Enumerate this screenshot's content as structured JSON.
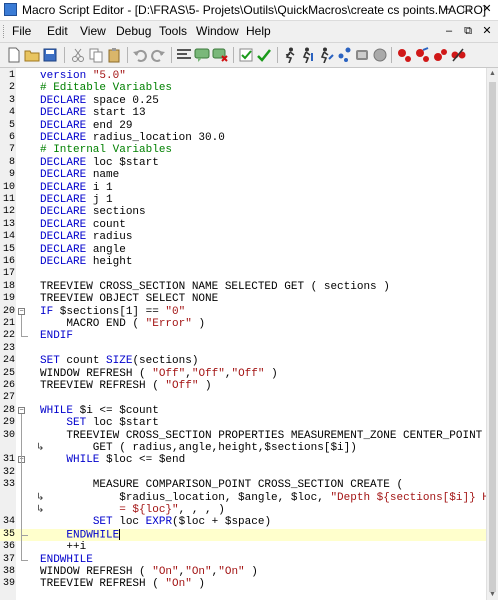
{
  "window": {
    "title": "Macro Script Editor - [D:\\FRAS\\5- Projets\\Outils\\QuickMacros\\create cs points.MACRO]",
    "buttons": {
      "minimize": "–",
      "maximize": "□",
      "close": "✕"
    }
  },
  "menu": {
    "items": [
      "File",
      "Edit",
      "View",
      "Debug",
      "Tools",
      "Window",
      "Help"
    ],
    "controls": {
      "minimize": "–",
      "restore": "⧉",
      "close": "✕"
    }
  },
  "toolbar": {
    "icons": [
      "new-file-icon",
      "open-folder-icon",
      "save-icon",
      "cut-icon",
      "copy-icon",
      "paste-icon",
      "undo-icon",
      "redo-icon",
      "insert-command-icon",
      "insert-comment-icon",
      "delete-comment-icon",
      "validate-icon",
      "check-syntax-icon",
      "run-icon",
      "step-into-icon",
      "step-over-icon",
      "step-out-icon",
      "run-to-cursor-icon",
      "stop-icon",
      "toggle-breakpoint-icon",
      "clear-breakpoints-icon",
      "breakpoint-next-icon",
      "breakpoint-prev-icon"
    ]
  },
  "editor": {
    "current_line": 35,
    "lines": [
      {
        "n": "1",
        "seg": [
          [
            "kw",
            "version"
          ],
          [
            "",
            ""
          ],
          [
            "str",
            " \"5.0\""
          ]
        ]
      },
      {
        "n": "2",
        "seg": [
          [
            "cm",
            "# Editable Variables"
          ]
        ]
      },
      {
        "n": "3",
        "seg": [
          [
            "kw",
            "DECLARE"
          ],
          [
            "",
            " space 0.25"
          ]
        ]
      },
      {
        "n": "4",
        "seg": [
          [
            "kw",
            "DECLARE"
          ],
          [
            "",
            " start 13"
          ]
        ]
      },
      {
        "n": "5",
        "seg": [
          [
            "kw",
            "DECLARE"
          ],
          [
            "",
            " end 29"
          ]
        ]
      },
      {
        "n": "6",
        "seg": [
          [
            "kw",
            "DECLARE"
          ],
          [
            "",
            " radius_location 30.0"
          ]
        ]
      },
      {
        "n": "7",
        "seg": [
          [
            "cm",
            "# Internal Variables"
          ]
        ]
      },
      {
        "n": "8",
        "seg": [
          [
            "kw",
            "DECLARE"
          ],
          [
            "",
            " loc $start"
          ]
        ]
      },
      {
        "n": "9",
        "seg": [
          [
            "kw",
            "DECLARE"
          ],
          [
            "",
            " name"
          ]
        ]
      },
      {
        "n": "10",
        "seg": [
          [
            "kw",
            "DECLARE"
          ],
          [
            "",
            " i 1"
          ]
        ]
      },
      {
        "n": "11",
        "seg": [
          [
            "kw",
            "DECLARE"
          ],
          [
            "",
            " j 1"
          ]
        ]
      },
      {
        "n": "12",
        "seg": [
          [
            "kw",
            "DECLARE"
          ],
          [
            "",
            " sections"
          ]
        ]
      },
      {
        "n": "13",
        "seg": [
          [
            "kw",
            "DECLARE"
          ],
          [
            "",
            " count"
          ]
        ]
      },
      {
        "n": "14",
        "seg": [
          [
            "kw",
            "DECLARE"
          ],
          [
            "",
            " radius"
          ]
        ]
      },
      {
        "n": "15",
        "seg": [
          [
            "kw",
            "DECLARE"
          ],
          [
            "",
            " angle"
          ]
        ]
      },
      {
        "n": "16",
        "seg": [
          [
            "kw",
            "DECLARE"
          ],
          [
            "",
            " height"
          ]
        ]
      },
      {
        "n": "17",
        "seg": []
      },
      {
        "n": "18",
        "seg": [
          [
            "",
            "TREEVIEW CROSS_SECTION NAME SELECTED GET ( sections )"
          ]
        ]
      },
      {
        "n": "19",
        "seg": [
          [
            "",
            "TREEVIEW OBJECT SELECT NONE"
          ]
        ]
      },
      {
        "n": "20",
        "fold": "start",
        "seg": [
          [
            "kw",
            "IF"
          ],
          [
            "",
            " $sections[1] == "
          ],
          [
            "str",
            "\"0\""
          ]
        ]
      },
      {
        "n": "21",
        "seg": [
          [
            "",
            "    MACRO END ( "
          ],
          [
            "str",
            "\"Error\""
          ],
          [
            "",
            " )"
          ]
        ]
      },
      {
        "n": "22",
        "fold": "end",
        "seg": [
          [
            "kw",
            "ENDIF"
          ]
        ]
      },
      {
        "n": "23",
        "seg": []
      },
      {
        "n": "24",
        "seg": [
          [
            "kw",
            "SET"
          ],
          [
            "",
            " count "
          ],
          [
            "kw",
            "SIZE"
          ],
          [
            "",
            "(sections)"
          ]
        ]
      },
      {
        "n": "25",
        "seg": [
          [
            "",
            "WINDOW REFRESH ( "
          ],
          [
            "str",
            "\"Off\""
          ],
          [
            "",
            ","
          ],
          [
            "str",
            "\"Off\""
          ],
          [
            "",
            ","
          ],
          [
            "str",
            "\"Off\""
          ],
          [
            "",
            " )"
          ]
        ]
      },
      {
        "n": "26",
        "seg": [
          [
            "",
            "TREEVIEW REFRESH ( "
          ],
          [
            "str",
            "\"Off\""
          ],
          [
            "",
            " )"
          ]
        ]
      },
      {
        "n": "27",
        "seg": []
      },
      {
        "n": "28",
        "fold": "start",
        "seg": [
          [
            "kw",
            "WHILE"
          ],
          [
            "",
            " $i <= $count"
          ]
        ]
      },
      {
        "n": "29",
        "seg": [
          [
            "",
            "    "
          ],
          [
            "kw",
            "SET"
          ],
          [
            "",
            " loc $start"
          ]
        ]
      },
      {
        "n": "30",
        "seg": [
          [
            "",
            "    TREEVIEW CROSS_SECTION PROPERTIES MEASUREMENT_ZONE CENTER_POINT"
          ]
        ]
      },
      {
        "n": "",
        "wrap": true,
        "seg": [
          [
            "",
            "        GET ( radius,angle,height,$sections[$i])"
          ]
        ]
      },
      {
        "n": "31",
        "fold": "start",
        "seg": [
          [
            "",
            "    "
          ],
          [
            "kw",
            "WHILE"
          ],
          [
            "",
            " $loc <= $end"
          ]
        ]
      },
      {
        "n": "32",
        "seg": []
      },
      {
        "n": "33",
        "seg": [
          [
            "",
            "        MEASURE COMPARISON_POINT CROSS_SECTION CREATE ("
          ]
        ]
      },
      {
        "n": "",
        "wrap": true,
        "seg": [
          [
            "",
            "            $radius_location, $angle, $loc, "
          ],
          [
            "str",
            "\"Depth ${sections[$i]} H"
          ]
        ]
      },
      {
        "n": "",
        "wrap": true,
        "seg": [
          [
            "str",
            "            = ${loc}\""
          ],
          [
            "",
            ", , , )"
          ]
        ]
      },
      {
        "n": "34",
        "seg": [
          [
            "",
            "        "
          ],
          [
            "kw",
            "SET"
          ],
          [
            "",
            " loc "
          ],
          [
            "kw",
            "EXPR"
          ],
          [
            "",
            "($loc + $space)"
          ]
        ]
      },
      {
        "n": "35",
        "fold": "end",
        "seg": [
          [
            "",
            "    "
          ],
          [
            "kw",
            "ENDWHILE"
          ]
        ]
      },
      {
        "n": "36",
        "seg": [
          [
            "",
            "    ++i"
          ]
        ]
      },
      {
        "n": "37",
        "fold": "end",
        "seg": [
          [
            "kw",
            "ENDWHILE"
          ]
        ]
      },
      {
        "n": "38",
        "seg": [
          [
            "",
            "WINDOW REFRESH ( "
          ],
          [
            "str",
            "\"On\""
          ],
          [
            "",
            ","
          ],
          [
            "str",
            "\"On\""
          ],
          [
            "",
            ","
          ],
          [
            "str",
            "\"On\""
          ],
          [
            "",
            " )"
          ]
        ]
      },
      {
        "n": "39",
        "seg": [
          [
            "",
            "TREEVIEW REFRESH ( "
          ],
          [
            "str",
            "\"On\""
          ],
          [
            "",
            " )"
          ]
        ]
      }
    ]
  }
}
